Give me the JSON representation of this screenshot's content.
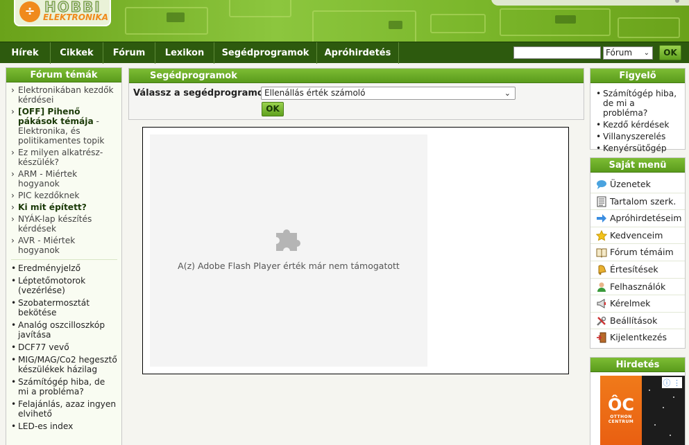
{
  "logo": {
    "mark": "÷",
    "top": "HOBBI",
    "sub": "ELEKTRONIKA"
  },
  "nav": {
    "items": [
      "Hírek",
      "Cikkek",
      "Fórum",
      "Lexikon",
      "Segédprogramok",
      "Apróhirdetés"
    ],
    "search_value": "",
    "search_scope": "Fórum",
    "ok_label": "OK"
  },
  "left": {
    "title": "Fórum témák",
    "topics": [
      {
        "bold": "",
        "text": "Elektronikában kezdők kérdései"
      },
      {
        "bold": "[OFF] Pihenő pákások témája",
        "text": " - Elektronika, és politikamentes topik"
      },
      {
        "bold": "",
        "text": "Ez milyen alkatrész-készülék?"
      },
      {
        "bold": "",
        "text": "ARM - Miértek hogyanok"
      },
      {
        "bold": "",
        "text": "PIC kezdőknek"
      },
      {
        "bold": "Ki mit épített?",
        "text": ""
      },
      {
        "bold": "",
        "text": "NYÁK-lap készítés kérdések"
      },
      {
        "bold": "",
        "text": "AVR - Miértek hogyanok"
      }
    ],
    "recent": [
      "Eredményjelző",
      "Léptetőmotorok (vezérlése)",
      "Szobatermosztát bekötése",
      "Analóg oszcilloszkóp javítása",
      "DCF77 vevő",
      "MIG/MAG/Co2 hegesztő készülékek házilag",
      "Számítógép hiba, de mi a probléma?",
      "Felajánlás, azaz ingyen elvihető",
      "LED-es index"
    ]
  },
  "main": {
    "title": "Segédprogramok",
    "select_label": "Válassz a segédprogramot",
    "selected_program": "Ellenállás érték számoló",
    "ok_label": "OK",
    "flash_message": "A(z) Adobe Flash Player érték már nem támogatott"
  },
  "watch": {
    "title": "Figyelő",
    "items": [
      "Számítógép hiba, de mi a probléma?",
      "Kezdő kérdések",
      "Villanyszerelés",
      "Kenyérsütőgép"
    ]
  },
  "own_menu": {
    "title": "Saját menü",
    "items": [
      {
        "label": "Üzenetek",
        "icon": "speech-bubble-icon"
      },
      {
        "label": "Tartalom szerk.",
        "icon": "document-icon"
      },
      {
        "label": "Apróhirdetéseim",
        "icon": "arrow-right-icon"
      },
      {
        "label": "Kedvenceim",
        "icon": "star-icon"
      },
      {
        "label": "Fórum témáim",
        "icon": "book-icon"
      },
      {
        "label": "Értesítések",
        "icon": "bell-icon"
      },
      {
        "label": "Felhasználók",
        "icon": "user-icon"
      },
      {
        "label": "Kérelmek",
        "icon": "megaphone-icon"
      },
      {
        "label": "Beállítások",
        "icon": "tools-icon"
      },
      {
        "label": "Kijelentkezés",
        "icon": "exit-door-icon"
      }
    ]
  },
  "ad": {
    "title": "Hirdetés",
    "brand_mark": "ÔC",
    "brand_line1": "OTTHON",
    "brand_line2": "CENTRUM",
    "info_glyph": "ⓘ ⋮"
  },
  "colors": {
    "nav_bg": "#2d5a0e",
    "header_green": "#8cc63e",
    "box_head": "#6aab28",
    "accent_orange": "#f08a1c"
  }
}
